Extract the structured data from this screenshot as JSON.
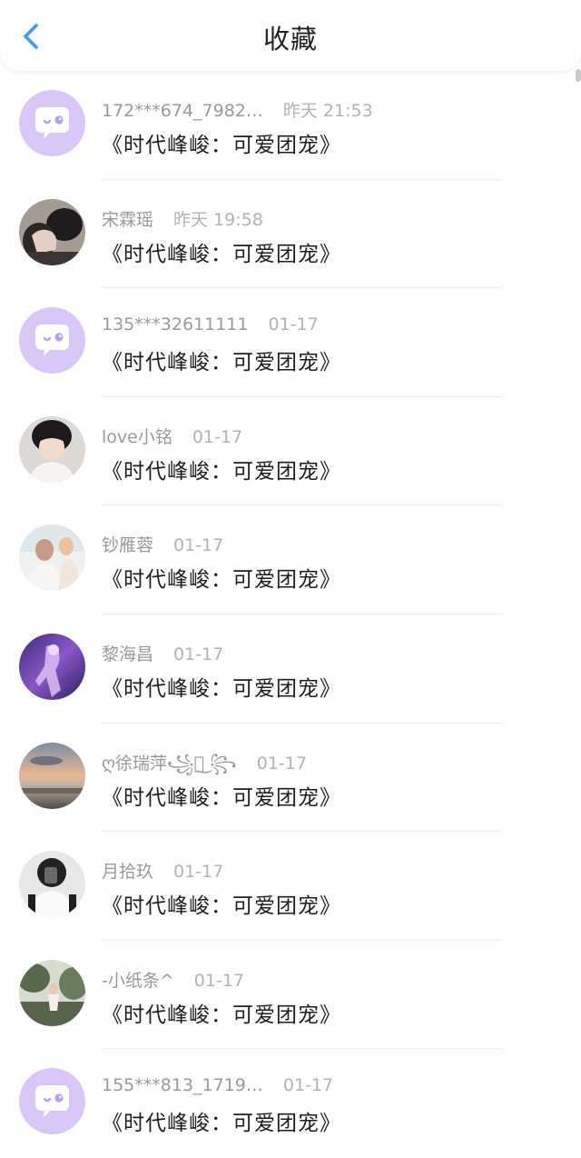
{
  "header": {
    "title": "收藏",
    "back_icon": "chevron-left-icon",
    "accent": "#3d9be9"
  },
  "items": [
    {
      "name": "172***674_7982…",
      "time": "昨天 21:53",
      "content": "《时代峰峻：可爱团宠》",
      "avatar": "default-chat-icon"
    },
    {
      "name": "宋霖瑶",
      "time": "昨天 19:58",
      "content": "《时代峰峻：可爱团宠》",
      "avatar": "user-photo"
    },
    {
      "name": "135***32611111",
      "time": "01-17",
      "content": "《时代峰峻：可爱团宠》",
      "avatar": "default-chat-icon"
    },
    {
      "name": "love小铭",
      "time": "01-17",
      "content": "《时代峰峻：可爱团宠》",
      "avatar": "user-photo"
    },
    {
      "name": "钞雁蓉",
      "time": "01-17",
      "content": "《时代峰峻：可爱团宠》",
      "avatar": "user-photo"
    },
    {
      "name": "黎海昌",
      "time": "01-17",
      "content": "《时代峰峻：可爱团宠》",
      "avatar": "user-photo"
    },
    {
      "name": "ღ徐瑞萍꧁ঁ͜ ꧂",
      "time": "01-17",
      "content": "《时代峰峻：可爱团宠》",
      "avatar": "user-photo"
    },
    {
      "name": "月拾玖",
      "time": "01-17",
      "content": "《时代峰峻：可爱团宠》",
      "avatar": "user-photo"
    },
    {
      "name": "-小纸条^",
      "time": "01-17",
      "content": "《时代峰峻：可爱团宠》",
      "avatar": "user-photo"
    },
    {
      "name": "155***813_1719…",
      "time": "01-17",
      "content": "《时代峰峻：可爱团宠》",
      "avatar": "default-chat-icon"
    }
  ]
}
